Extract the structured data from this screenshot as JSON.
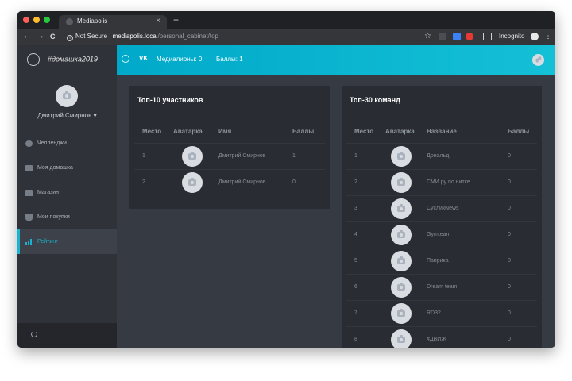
{
  "browser": {
    "tab_title": "Mediapolis",
    "tab_close": "×",
    "new_tab": "+",
    "back": "←",
    "forward": "→",
    "reload": "C",
    "security": "Not Secure",
    "url_domain": "mediapolis.local",
    "url_path": "/personal_cabinet/top",
    "incognito": "Incognito",
    "star": "☆",
    "menu": "⋮"
  },
  "sidebar": {
    "logo": "#домашка2019",
    "user_name": "Дмитрий Смирнов",
    "user_caret": "▾",
    "items": [
      {
        "label": "Челленджи",
        "icon": "compass-icon"
      },
      {
        "label": "Моя домашка",
        "icon": "book-icon"
      },
      {
        "label": "Магазин",
        "icon": "store-icon"
      },
      {
        "label": "Мои покупки",
        "icon": "basket-icon"
      },
      {
        "label": "Рейтинг",
        "icon": "chart-icon",
        "active": true
      }
    ]
  },
  "header": {
    "vk": "VK",
    "medalions": "Медиалионы: 0",
    "points": "Баллы: 1"
  },
  "participants": {
    "title": "Топ-10 участников",
    "columns": [
      "Место",
      "Аватарка",
      "Имя",
      "Баллы"
    ],
    "rows": [
      {
        "place": "1",
        "name": "Дмитрий Смирнов",
        "points": "1"
      },
      {
        "place": "2",
        "name": "Дмитрий Смирнов",
        "points": "0"
      }
    ]
  },
  "teams": {
    "title": "Топ-30 команд",
    "columns": [
      "Место",
      "Аватарка",
      "Название",
      "Баллы"
    ],
    "rows": [
      {
        "place": "1",
        "name": "Дональд",
        "points": "0"
      },
      {
        "place": "2",
        "name": "СМИ.ру по нитке",
        "points": "0"
      },
      {
        "place": "3",
        "name": "СусликNews",
        "points": "0"
      },
      {
        "place": "4",
        "name": "Gymteam",
        "points": "0"
      },
      {
        "place": "5",
        "name": "Паприка",
        "points": "0"
      },
      {
        "place": "6",
        "name": "Dream team",
        "points": "0"
      },
      {
        "place": "7",
        "name": "RD32",
        "points": "0"
      },
      {
        "place": "8",
        "name": "#ДВИЖ",
        "points": "0"
      }
    ]
  },
  "colors": {
    "accent": "#1bb4d0",
    "header_gradient_start": "#00a9c9",
    "header_gradient_end": "#14c0d6"
  }
}
